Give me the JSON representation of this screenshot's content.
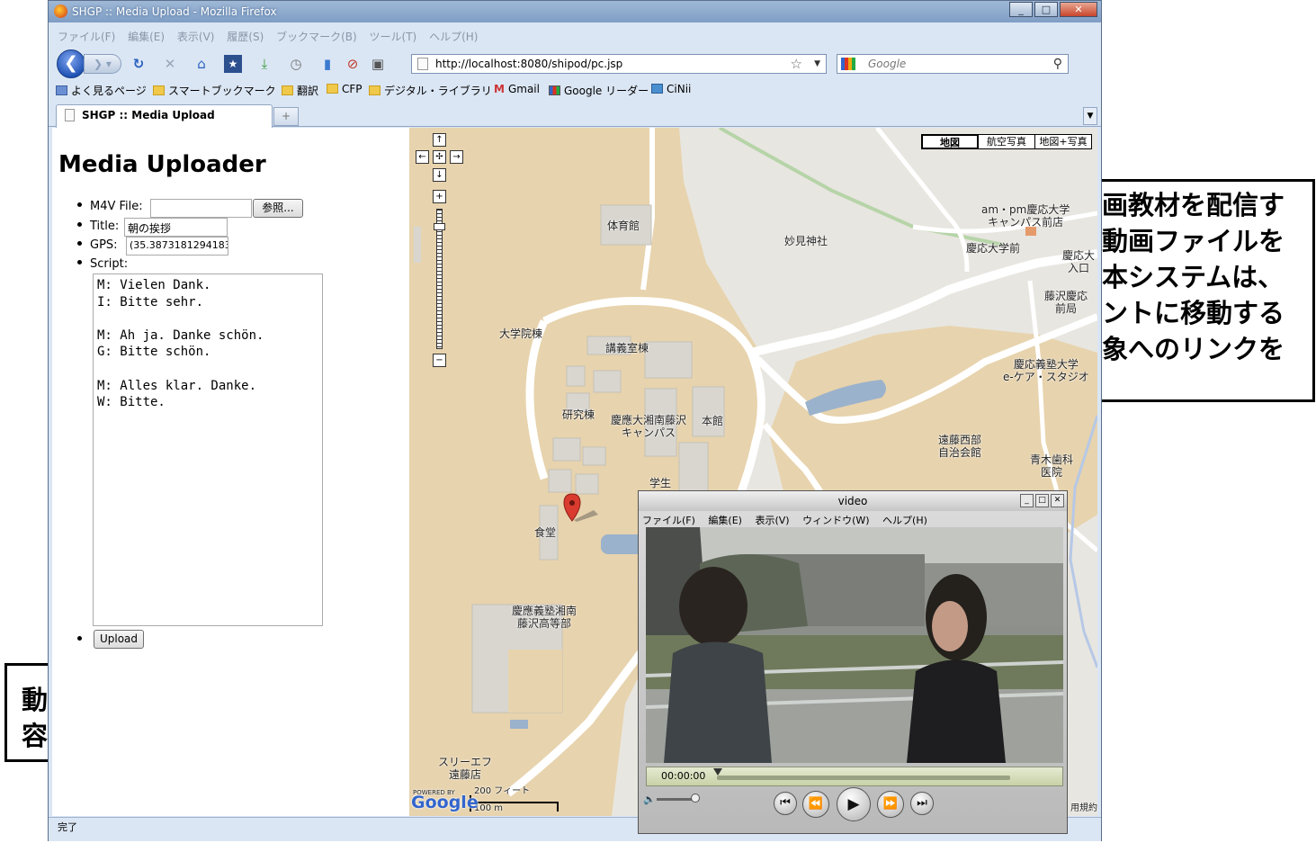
{
  "annotations": {
    "right_lines": [
      "画教材を配信す",
      "動画ファイルを",
      "本システムは、",
      "ントに移動する",
      "象へのリンクを"
    ],
    "left_lines": [
      "動",
      "容"
    ]
  },
  "window": {
    "title": "SHGP :: Media Upload - Mozilla Firefox",
    "controls": {
      "minimize": "_",
      "maximize": "□",
      "close": "✕"
    }
  },
  "menu": [
    "ファイル(F)",
    "編集(E)",
    "表示(V)",
    "履歴(S)",
    "ブックマーク(B)",
    "ツール(T)",
    "ヘルプ(H)"
  ],
  "nav": {
    "back_icon": "back-arrow-icon",
    "url": "http://localhost:8080/shipod/pc.jsp",
    "search_placeholder": "Google"
  },
  "bookmarks": [
    "よく見るページ",
    "スマートブックマーク",
    "翻訳",
    "CFP",
    "デジタル・ライブラリ",
    "Gmail",
    "Google リーダー",
    "CiNii"
  ],
  "tab": {
    "title": "SHGP :: Media Upload",
    "new_tab": "+"
  },
  "uploader": {
    "heading": "Media Uploader",
    "m4v_label": "M4V File:",
    "browse_button": "参照...",
    "title_label": "Title:",
    "title_value": "朝の挨拶",
    "gps_label": "GPS:",
    "gps_value": "(35.38731812941834",
    "script_label": "Script:",
    "script_text": "M: Vielen Dank.\nI: Bitte sehr.\n\nM: Ah ja. Danke schön.\nG: Bitte schön.\n\nM: Alles klar. Danke.\nW: Bitte.",
    "upload_button": "Upload"
  },
  "map": {
    "types": [
      "地図",
      "航空写真",
      "地図+写真"
    ],
    "labels": {
      "gym": "体育館",
      "shrine": "妙見神社",
      "shop": "am・pm慶応大学\nキャンパス前店",
      "station": "慶応大学前",
      "entrance": "慶応大\n入口",
      "fujisawa": "藤沢慶応\n前局",
      "grad": "大学院棟",
      "lecture": "講義室棟",
      "research": "研究棟",
      "campus": "慶應大湘南藤沢\nキャンパス",
      "main": "本館",
      "student": "学生",
      "cafeteria": "食堂",
      "ecare": "慶応義塾大学\ne-ケア・スタジオ",
      "endo": "遠藤西部\n自治会館",
      "aoki": "青木歯科\n医院",
      "highschool": "慶應義塾湘南\n藤沢高等部",
      "sleef": "スリーエフ\n遠藤店",
      "scale_ft": "200 フィート",
      "scale_m": "100 m",
      "powered": "POWERED BY",
      "google": "Google",
      "terms": "用規約"
    },
    "zoom_in": "+",
    "zoom_out": "−"
  },
  "video": {
    "title": "video",
    "menu": [
      "ファイル(F)",
      "編集(E)",
      "表示(V)",
      "ウィンドウ(W)",
      "ヘルプ(H)"
    ],
    "time": "00:00:00"
  },
  "status": "完了",
  "colors": {
    "map_campus": "#e7d3ad",
    "map_road": "#ffffff",
    "map_water": "#9bb2cc",
    "browser_chrome": "#dbe6f4"
  }
}
